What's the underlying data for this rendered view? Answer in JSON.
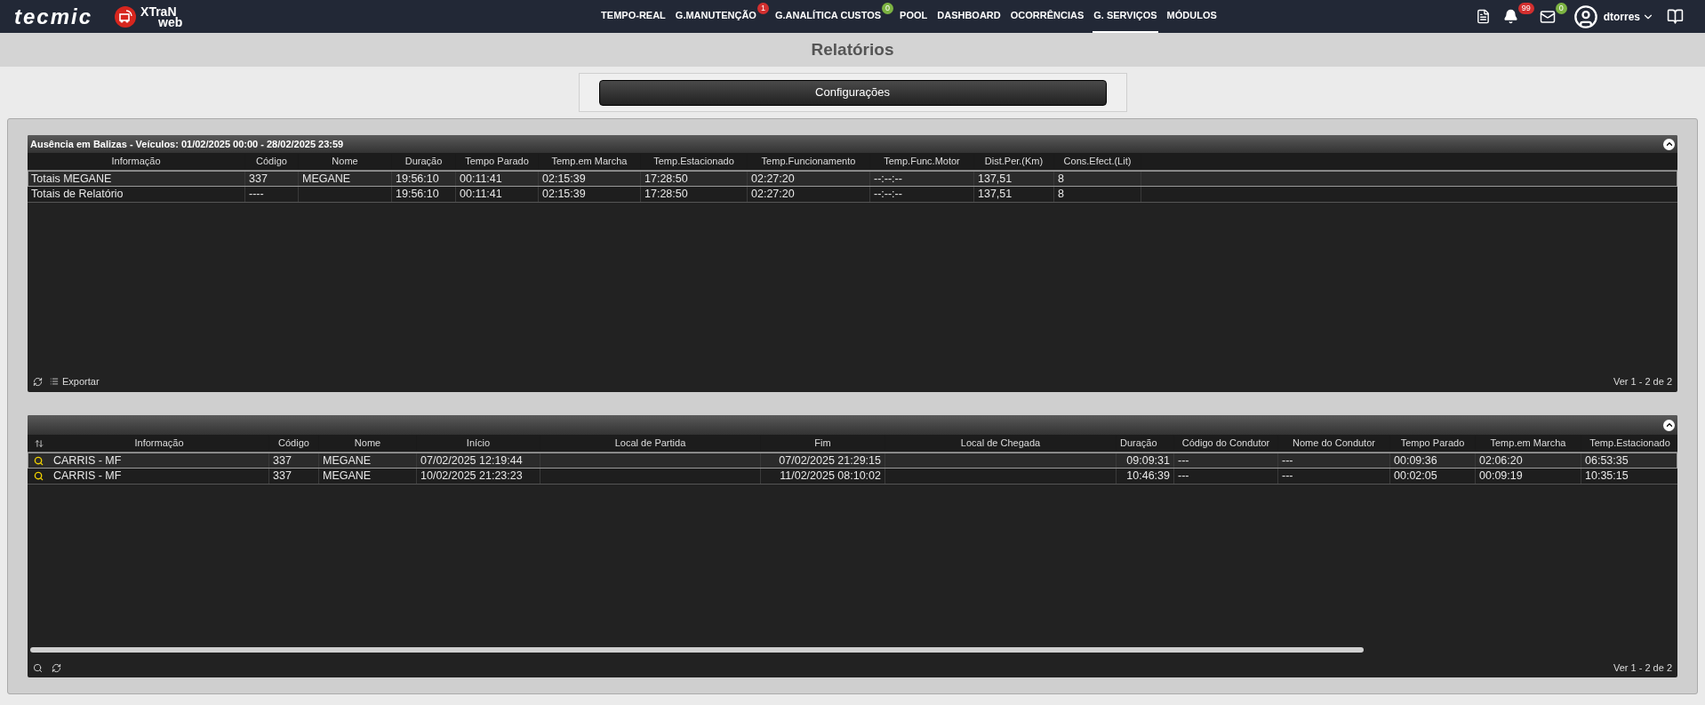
{
  "brand": {
    "company": "tecmic",
    "product_top": "XTraN",
    "product_bottom": "web"
  },
  "nav": [
    {
      "label": "TEMPO-REAL",
      "selected": false
    },
    {
      "label": "G.MANUTENÇÃO",
      "selected": false,
      "badge": "1",
      "color": "#d32f2f"
    },
    {
      "label": "G.ANALÍTICA CUSTOS",
      "selected": false,
      "badge": "0",
      "color": "#7cb342"
    },
    {
      "label": "POOL",
      "selected": false
    },
    {
      "label": "DASHBOARD",
      "selected": false
    },
    {
      "label": "OCORRÊNCIAS",
      "selected": false
    },
    {
      "label": "G. SERVIÇOS",
      "selected": true
    },
    {
      "label": "MÓDULOS",
      "selected": false
    }
  ],
  "notifications": {
    "badge": "99",
    "color": "#d32f2f"
  },
  "messages": {
    "badge": "0",
    "color": "#7cb342"
  },
  "user": {
    "name": "dtorres"
  },
  "page_title": "Relatórios",
  "config_button": "Configurações",
  "summary_grid": {
    "title": "Ausência em Balizas - Veículos: 01/02/2025 00:00 - 28/02/2025 23:59",
    "columns": [
      "Informação",
      "Código",
      "Nome",
      "Duração",
      "Tempo Parado",
      "Temp.em Marcha",
      "Temp.Estacionado",
      "Temp.Funcionamento",
      "Temp.Func.Motor",
      "Dist.Per.(Km)",
      "Cons.Efect.(Lit)"
    ],
    "rows": [
      {
        "selected": true,
        "cells": [
          "Totais MEGANE",
          "337",
          "MEGANE",
          "19:56:10",
          "00:11:41",
          "02:15:39",
          "17:28:50",
          "02:27:20",
          "--:--:--",
          "137,51",
          "8"
        ]
      },
      {
        "selected": false,
        "cells": [
          "Totais de Relatório",
          "----",
          "",
          "19:56:10",
          "00:11:41",
          "02:15:39",
          "17:28:50",
          "02:27:20",
          "--:--:--",
          "137,51",
          "8"
        ]
      }
    ],
    "export_label": "Exportar",
    "pager": "Ver 1 - 2 de 2"
  },
  "detail_grid": {
    "columns": [
      "Informação",
      "Código",
      "Nome",
      "Início",
      "Local de Partida",
      "Fim",
      "Local de Chegada",
      "Duração",
      "Código do Condutor",
      "Nome do Condutor",
      "Tempo Parado",
      "Temp.em Marcha",
      "Temp.Estacionado"
    ],
    "rows": [
      {
        "selected": true,
        "cells": [
          "CARRIS - MF",
          "337",
          "MEGANE",
          "07/02/2025 12:19:44",
          "",
          "07/02/2025 21:29:15",
          "",
          "09:09:31",
          "---",
          "---",
          "00:09:36",
          "02:06:20",
          "06:53:35"
        ]
      },
      {
        "selected": false,
        "cells": [
          "CARRIS - MF",
          "337",
          "MEGANE",
          "10/02/2025 21:23:23",
          "",
          "11/02/2025 08:10:02",
          "",
          "10:46:39",
          "---",
          "---",
          "00:02:05",
          "00:09:19",
          "10:35:15"
        ]
      }
    ],
    "pager": "Ver 1 - 2 de 2"
  }
}
